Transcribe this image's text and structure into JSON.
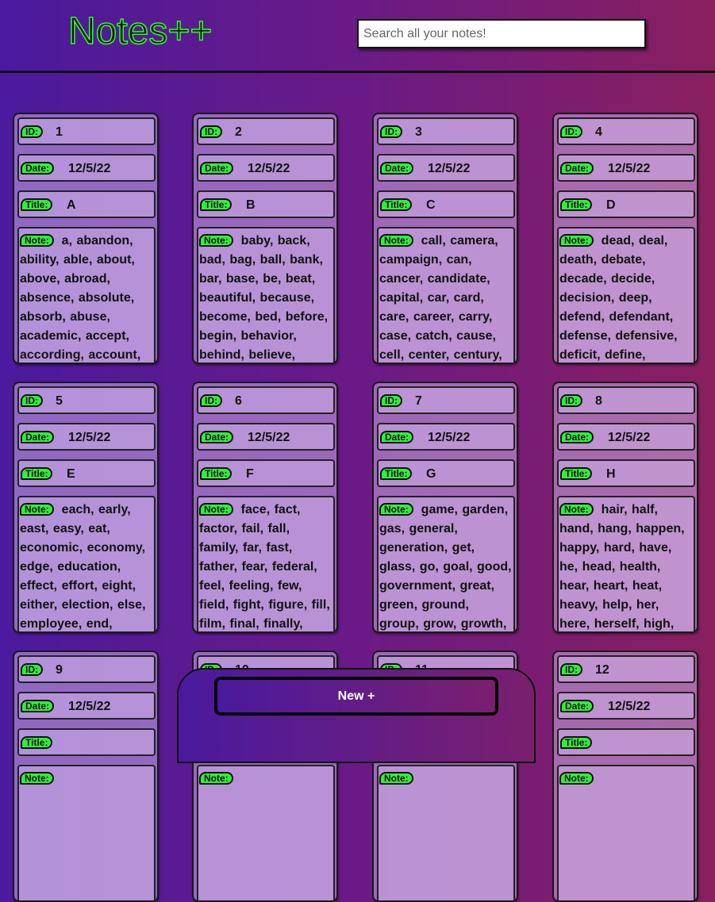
{
  "app": {
    "title": "Notes++"
  },
  "search": {
    "placeholder": "Search all your notes!"
  },
  "labels": {
    "id": "ID:",
    "date": "Date:",
    "title": "Title:",
    "note": "Note:"
  },
  "notes": [
    {
      "id": "1",
      "date": "12/5/22",
      "title": "A",
      "note": "a, abandon, ability, able, about, above, abroad, absence, absolute, absorb, abuse, academic, accept, according, account,"
    },
    {
      "id": "2",
      "date": "12/5/22",
      "title": "B",
      "note": "baby, back, bad, bag, ball, bank, bar, base, be, beat, beautiful, because, become, bed, before, begin, behavior, behind, believe,"
    },
    {
      "id": "3",
      "date": "12/5/22",
      "title": "C",
      "note": "call, camera, campaign, can, cancer, candidate, capital, car, card, care, career, carry, case, catch, cause, cell, center, century,"
    },
    {
      "id": "4",
      "date": "12/5/22",
      "title": "D",
      "note": "dead, deal, death, debate, decade, decide, decision, deep, defend, defendant, defense, defensive, deficit, define, definitely,"
    },
    {
      "id": "5",
      "date": "12/5/22",
      "title": "E",
      "note": "each, early, east, easy, eat, economic, economy, edge, education, effect, effort, eight, either, election, else, employee, end,"
    },
    {
      "id": "6",
      "date": "12/5/22",
      "title": "F",
      "note": "face, fact, factor, fail, fall, family, far, fast, father, fear, federal, feel, feeling, few, field, fight, figure, fill, film, final, finally, financial, find, fine,"
    },
    {
      "id": "7",
      "date": "12/5/22",
      "title": "G",
      "note": "game, garden, gas, general, generation, get, glass, go, goal, good, government, great, green, ground, group, grow, growth, guess,"
    },
    {
      "id": "8",
      "date": "12/5/22",
      "title": "H",
      "note": "hair, half, hand, hang, happen, happy, hard, have, he, head, health, hear, heart, heat, heavy, help, her, here, herself, high, him,"
    },
    {
      "id": "9",
      "date": "12/5/22",
      "title": "",
      "note": ""
    },
    {
      "id": "10",
      "date": "",
      "title": "",
      "note": ""
    },
    {
      "id": "11",
      "date": "",
      "title": "",
      "note": ""
    },
    {
      "id": "12",
      "date": "12/5/22",
      "title": "",
      "note": ""
    }
  ],
  "footer": {
    "new_button_label": "New +"
  }
}
